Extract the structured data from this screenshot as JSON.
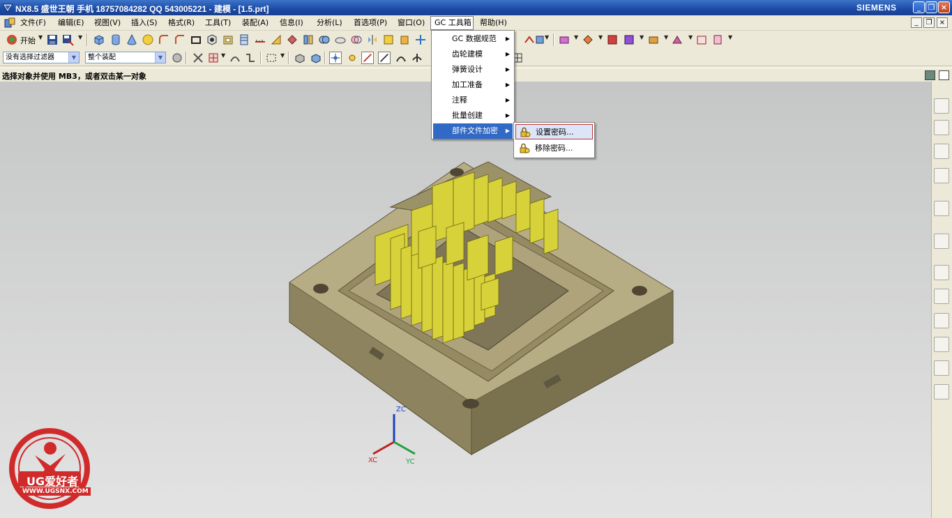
{
  "window": {
    "title": "NX8.5 盛世王朝 手机 18757084282 QQ 543005221 - 建模 - [1.5.prt]",
    "brand": "SIEMENS",
    "controls": [
      "_",
      "❐",
      "×"
    ]
  },
  "menubar": {
    "items": [
      "文件(F)",
      "编辑(E)",
      "视图(V)",
      "插入(S)",
      "格式(R)",
      "工具(T)",
      "装配(A)",
      "信息(I)",
      "分析(L)",
      "首选项(P)",
      "窗口(O)",
      "GC 工具箱",
      "帮助(H)"
    ],
    "active": "GC 工具箱",
    "mdi_controls": [
      "_",
      "❐",
      "×"
    ]
  },
  "toolbar": {
    "start_label": "开始",
    "selection_filter": "没有选择过滤器",
    "assembly_scope": "整个装配"
  },
  "status": {
    "message": "选择对象并使用 MB3，或者双击某一对象"
  },
  "gc_menu": {
    "items": [
      {
        "label": "GC 数据规范",
        "submenu": true
      },
      {
        "label": "齿轮建模",
        "submenu": true
      },
      {
        "label": "弹簧设计",
        "submenu": true
      },
      {
        "label": "加工准备",
        "submenu": true
      },
      {
        "label": "注释",
        "submenu": true
      },
      {
        "label": "批量创建",
        "submenu": true
      },
      {
        "label": "部件文件加密",
        "submenu": true,
        "highlighted": true
      }
    ]
  },
  "encrypt_submenu": {
    "items": [
      {
        "label": "设置密码...",
        "icon": "key-lock-icon",
        "highlighted": true
      },
      {
        "label": "移除密码...",
        "icon": "key-lock-icon"
      }
    ]
  },
  "triad": {
    "zc": "ZC",
    "xc": "XC",
    "yc": "YC",
    "colors": {
      "zc": "#2040c0",
      "xc": "#c02020",
      "yc": "#20a040"
    }
  },
  "watermark": {
    "brand_text": "UG爱好者",
    "url": "WWW.UGSNX.COM"
  },
  "colors": {
    "model_body": "#b7ad85",
    "model_dark": "#7f7658",
    "parting_sheets": "#d8d23a",
    "menu_highlight": "#3169c6"
  }
}
